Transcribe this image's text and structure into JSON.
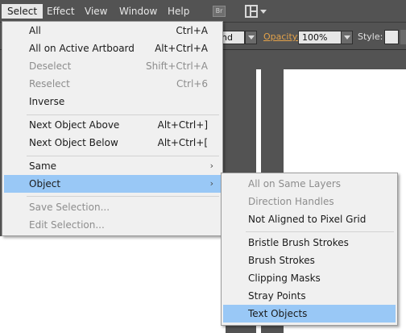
{
  "menubar": {
    "items": [
      {
        "label": "Select",
        "active": true
      },
      {
        "label": "Effect"
      },
      {
        "label": "View"
      },
      {
        "label": "Window"
      },
      {
        "label": "Help"
      }
    ],
    "bridge_badge": "Br",
    "workspace_icon": "arrange-documents-icon"
  },
  "controlbar": {
    "blend_value": "nd",
    "opacity_label": "Opacity:",
    "opacity_value": "100%",
    "style_label": "Style:"
  },
  "select_menu": {
    "items": [
      {
        "label": "All",
        "shortcut": "Ctrl+A"
      },
      {
        "label": "All on Active Artboard",
        "shortcut": "Alt+Ctrl+A"
      },
      {
        "label": "Deselect",
        "shortcut": "Shift+Ctrl+A",
        "disabled": true
      },
      {
        "label": "Reselect",
        "shortcut": "Ctrl+6",
        "disabled": true
      },
      {
        "label": "Inverse"
      },
      {
        "label": "Next Object Above",
        "shortcut": "Alt+Ctrl+]"
      },
      {
        "label": "Next Object Below",
        "shortcut": "Alt+Ctrl+["
      },
      {
        "label": "Same",
        "submenu": true
      },
      {
        "label": "Object",
        "submenu": true,
        "highlighted": true
      },
      {
        "label": "Save Selection...",
        "disabled": true
      },
      {
        "label": "Edit Selection...",
        "disabled": true
      }
    ],
    "submenu_arrow": "›"
  },
  "object_submenu": {
    "items": [
      {
        "label": "All on Same Layers",
        "disabled": true
      },
      {
        "label": "Direction Handles",
        "disabled": true
      },
      {
        "label": "Not Aligned to Pixel Grid"
      },
      {
        "label": "Bristle Brush Strokes"
      },
      {
        "label": "Brush Strokes"
      },
      {
        "label": "Clipping Masks"
      },
      {
        "label": "Stray Points"
      },
      {
        "label": "Text Objects",
        "highlighted": true
      }
    ]
  },
  "colors": {
    "highlight": "#99c8f6",
    "menu_bg": "#f0f0f0",
    "chrome": "#535353",
    "opacity_accent": "#e3a24a"
  }
}
